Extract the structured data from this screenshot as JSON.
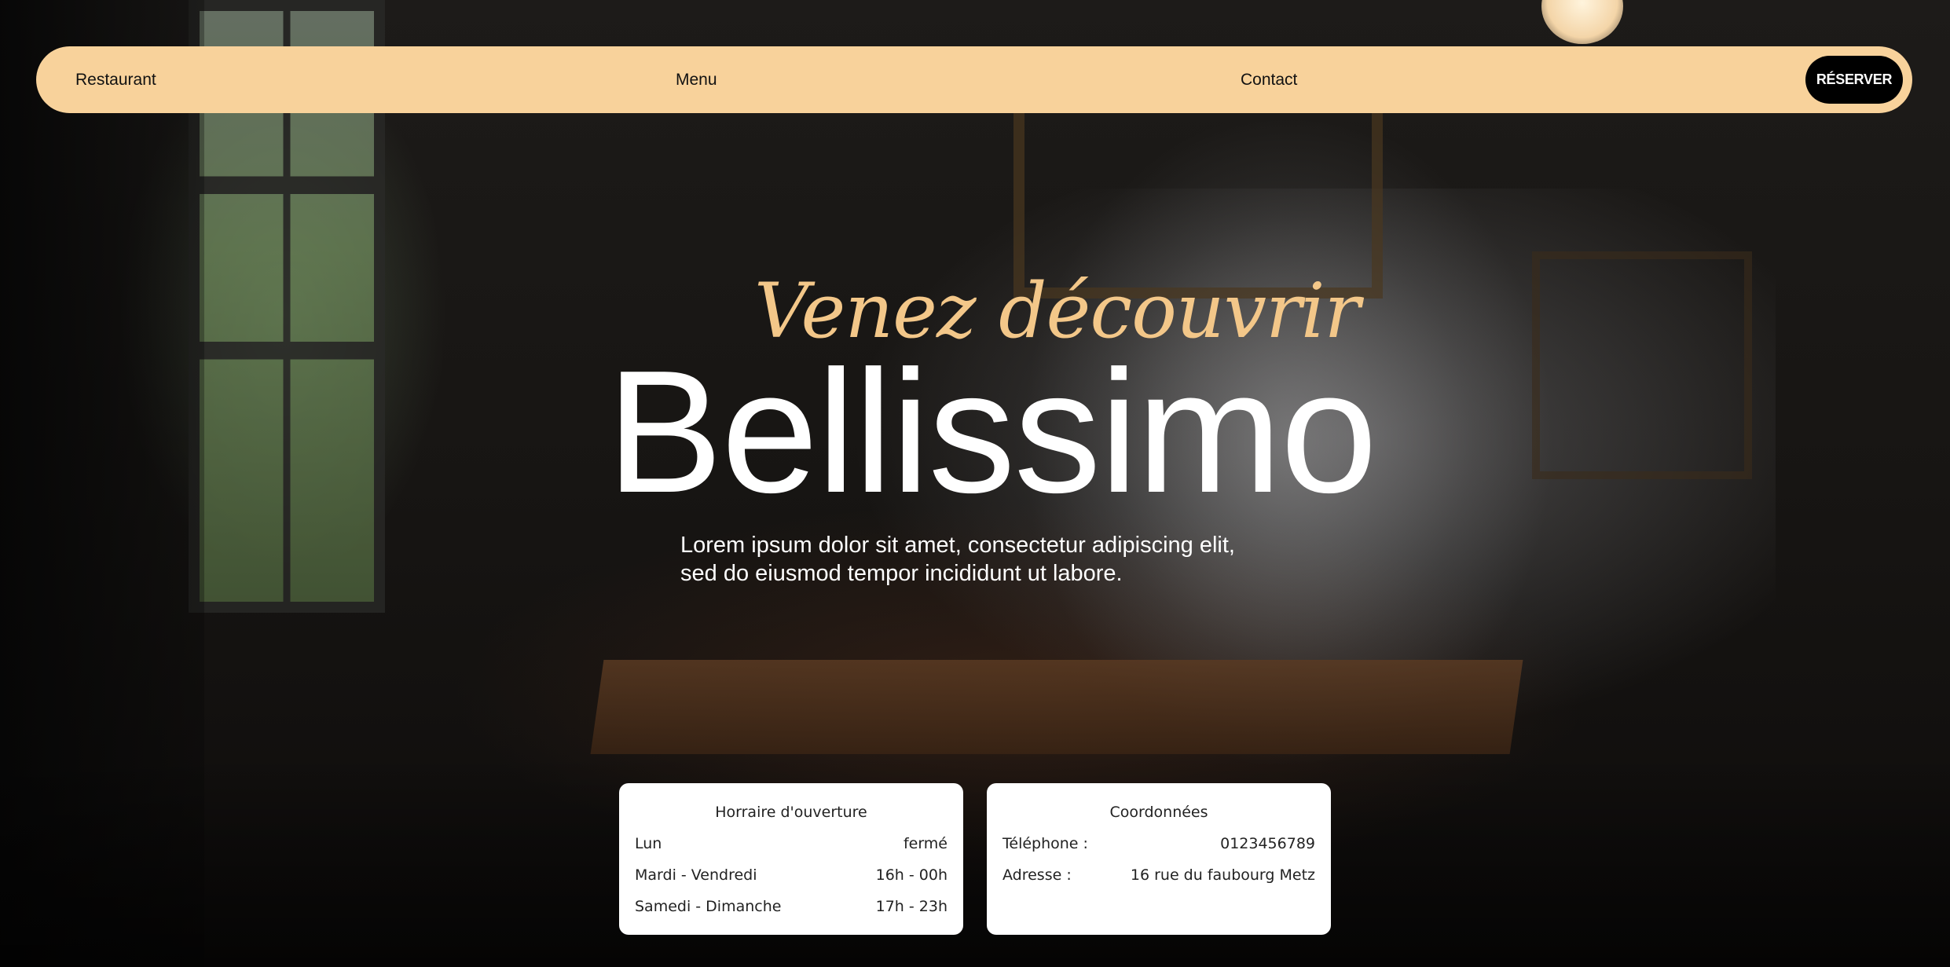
{
  "navbar": {
    "brand_label": "Restaurant",
    "menu_label": "Menu",
    "contact_label": "Contact",
    "reserve_label": "RÉSERVER",
    "background_color": "#f8d29b"
  },
  "hero": {
    "subtitle": "Venez découvrir",
    "title": "Bellissimo",
    "lede_line1": "Lorem ipsum dolor sit amet, consectetur adipiscing elit,",
    "lede_line2": "sed do eiusmod tempor incididunt ut labore.",
    "subtitle_color": "#f3c789"
  },
  "hours_card": {
    "title": "Horraire d'ouverture",
    "rows": [
      {
        "day": "Lun",
        "time": "fermé"
      },
      {
        "day": "Mardi - Vendredi",
        "time": "16h - 00h"
      },
      {
        "day": "Samedi - Dimanche",
        "time": "17h - 23h"
      }
    ]
  },
  "contact_card": {
    "title": "Coordonnées",
    "rows": [
      {
        "label": "Téléphone :",
        "value": "0123456789"
      },
      {
        "label": "Adresse :",
        "value": "16 rue du faubourg Metz"
      }
    ]
  }
}
